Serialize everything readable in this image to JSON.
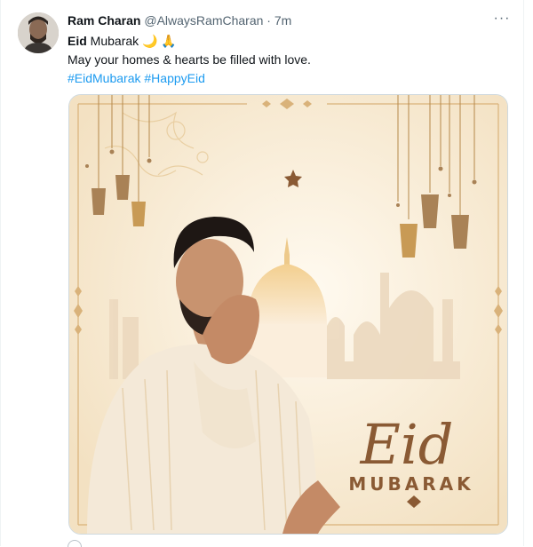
{
  "tweet": {
    "author_name": "Ram Charan",
    "handle": "@AlwaysRamCharan",
    "separator": "·",
    "time": "7m",
    "more_label": "···",
    "line1_bold": "Eid",
    "line1_rest": " Mubarak ",
    "line1_emoji": "🌙 🙏",
    "line2": "May your homes & hearts be filled with love.",
    "hashtags": [
      "#EidMubarak",
      "#HappyEid"
    ]
  },
  "media": {
    "card_title": "Eid",
    "card_subtitle": "MUBARAK"
  },
  "colors": {
    "link": "#1d9bf0",
    "secondary": "#536471",
    "gold": "#b5884a",
    "brown": "#8a5a34"
  }
}
